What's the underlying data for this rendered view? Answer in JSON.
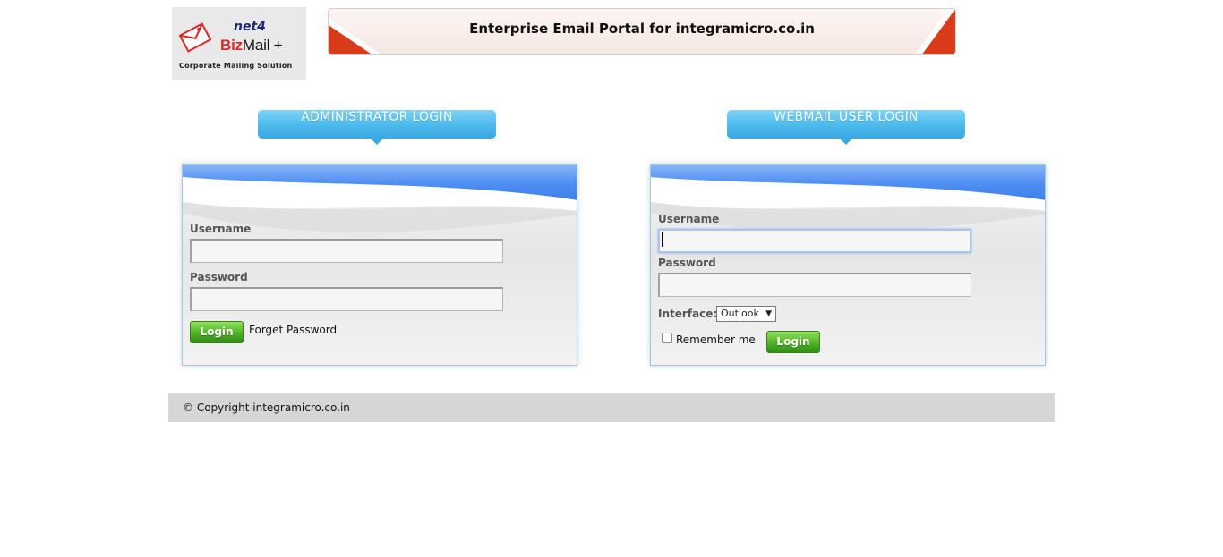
{
  "logo": {
    "brand_top": "net4",
    "brand_name_part1": "Biz",
    "brand_name_part2": "Mail +",
    "tagline": "Corporate Mailing Solution"
  },
  "header": {
    "title": "Enterprise Email Portal for integramicro.co.in"
  },
  "admin_login": {
    "tab_label": "ADMINISTRATOR LOGIN",
    "username_label": "Username",
    "username_value": "",
    "password_label": "Password",
    "password_value": "",
    "login_button": "Login",
    "forget_password": "Forget Password"
  },
  "webmail_login": {
    "tab_label": "WEBMAIL USER LOGIN",
    "username_label": "Username",
    "username_value": "",
    "password_label": "Password",
    "password_value": "",
    "interface_label": "Interface:",
    "interface_selected": "Outlook",
    "remember_me_label": "Remember me",
    "remember_me_checked": false,
    "login_button": "Login"
  },
  "footer": {
    "copyright": "© Copyright integramicro.co.in"
  },
  "icons": {
    "logo_icon": "envelope-icon",
    "dropdown_icon": "caret-down-icon"
  },
  "colors": {
    "tab_blue": "#4cb9ec",
    "panel_header_blue": "#4f8ef2",
    "login_green": "#54b72b",
    "banner_red": "#d93a1a"
  }
}
